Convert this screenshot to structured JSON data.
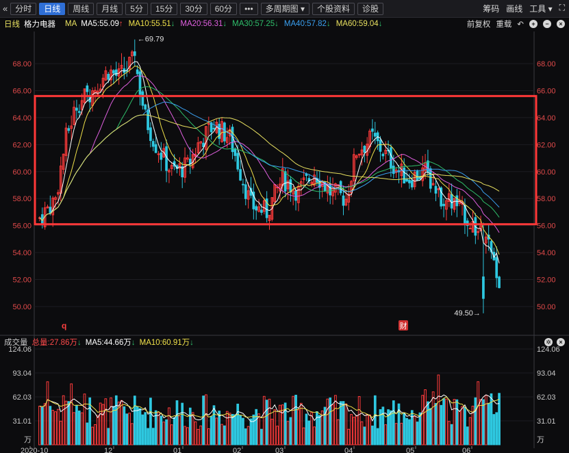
{
  "toolbar": {
    "back": "«",
    "tabs": [
      "分时",
      "日线",
      "周线",
      "月线",
      "5分",
      "15分",
      "30分",
      "60分",
      "•••",
      "多周期图",
      "个股资料",
      "诊股"
    ],
    "active_tab": 1,
    "right_items": [
      "筹码",
      "画线",
      "工具"
    ]
  },
  "ma_bar": {
    "period": "日线",
    "stock": "格力电器",
    "ma_label": "MA",
    "items": [
      {
        "text": "MA5:55.09",
        "arrow": "↑",
        "color": "#ffffff"
      },
      {
        "text": "MA10:55.51",
        "arrow": "↓",
        "color": "#f0e14a"
      },
      {
        "text": "MA20:56.31",
        "arrow": "↓",
        "color": "#e060e0"
      },
      {
        "text": "MA30:57.25",
        "arrow": "↓",
        "color": "#2fbf6b"
      },
      {
        "text": "MA40:57.82",
        "arrow": "↓",
        "color": "#3aa0f0"
      },
      {
        "text": "MA60:59.04",
        "arrow": "↓",
        "color": "#e8e060"
      }
    ],
    "right": [
      "前复权",
      "重载"
    ]
  },
  "vol_bar": {
    "label": "成交量",
    "total": "总量:27.86万",
    "ma5": "MA5:44.66万",
    "ma10": "MA10:60.91万"
  },
  "chart_data": {
    "type": "candlestick",
    "price_ticks": [
      "68.00",
      "66.00",
      "64.00",
      "62.00",
      "60.00",
      "58.00",
      "56.00",
      "54.00",
      "52.00",
      "50.00"
    ],
    "price_range": [
      49.0,
      70.0
    ],
    "annotations": {
      "high": "←69.79",
      "low": "49.50→"
    },
    "markers": {
      "q": "q",
      "fin": "财"
    },
    "volume_ticks": [
      "124.06",
      "93.04",
      "62.03",
      "31.01",
      "万"
    ],
    "volume_range": [
      0,
      124.06
    ],
    "months": [
      "2020-10",
      "12",
      "01",
      "02",
      "03",
      "04",
      "05",
      "06"
    ],
    "highlight_box": {
      "price_top": 65.6,
      "price_bottom": 56.1
    }
  },
  "colors": {
    "up": "#ff3b3b",
    "down": "#2ec8e0",
    "box": "#ff3838"
  }
}
